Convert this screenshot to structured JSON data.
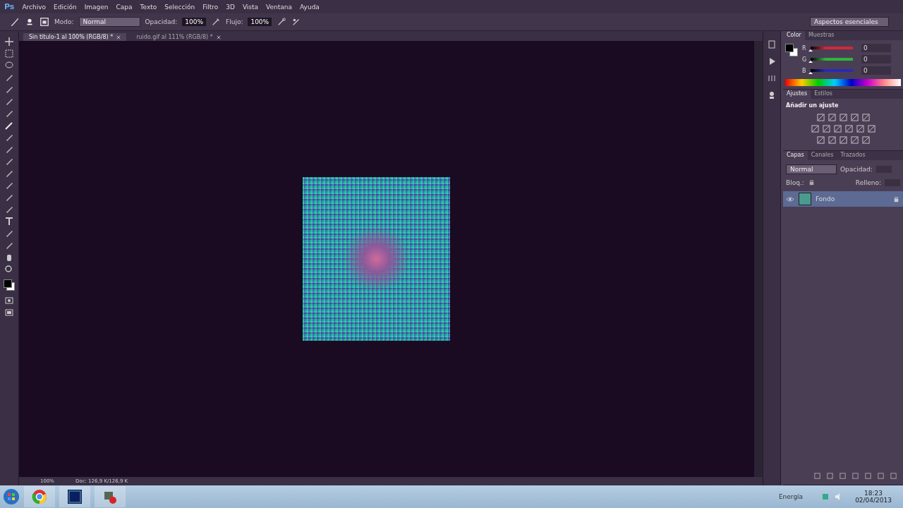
{
  "app_logo": "Ps",
  "menu": [
    "Archivo",
    "Edición",
    "Imagen",
    "Capa",
    "Texto",
    "Selección",
    "Filtro",
    "3D",
    "Vista",
    "Ventana",
    "Ayuda"
  ],
  "options": {
    "mode_label": "Modo:",
    "mode": "Normal",
    "opacity_label": "Opacidad:",
    "opacity": "100%",
    "flow_label": "Flujo:",
    "flow": "100%",
    "workspace": "Aspectos esenciales"
  },
  "doc_tabs": [
    {
      "label": "Sin título-1 al 100% (RGB/8) *",
      "selected": true
    },
    {
      "label": "ruido.gif al 111% (RGB/8) *",
      "selected": false
    }
  ],
  "status_bar": {
    "zoom": "100%",
    "doc_info": "Doc: 126,9 K/126,9 K"
  },
  "color_panel": {
    "tabs": [
      {
        "label": "Color",
        "selected": true
      },
      {
        "label": "Muestras",
        "selected": false
      }
    ],
    "channels": [
      {
        "name": "R",
        "value": "0",
        "level": 0,
        "color": "#d0283a"
      },
      {
        "name": "G",
        "value": "0",
        "level": 0,
        "color": "#2fb43c"
      },
      {
        "name": "B",
        "value": "0",
        "level": 0,
        "color": "#2a2ab8"
      }
    ]
  },
  "adjustments_panel": {
    "tabs": [
      {
        "label": "Ajustes",
        "selected": true
      },
      {
        "label": "Estilos",
        "selected": false
      }
    ],
    "heading": "Añadir un ajuste"
  },
  "layers_panel": {
    "tabs": [
      {
        "label": "Capas",
        "selected": true
      },
      {
        "label": "Canales",
        "selected": false
      },
      {
        "label": "Trazados",
        "selected": false
      }
    ],
    "blend_mode": "Normal",
    "opacity_label": "Opacidad:",
    "lock_label": "Bloq.:",
    "fill_label": "Relleno:",
    "layers": [
      {
        "name": "Fondo",
        "visible": true,
        "selected": true,
        "locked": true
      }
    ]
  },
  "taskbar": {
    "tray_label": "Energía",
    "time": "18:23",
    "date": "02/04/2013"
  }
}
